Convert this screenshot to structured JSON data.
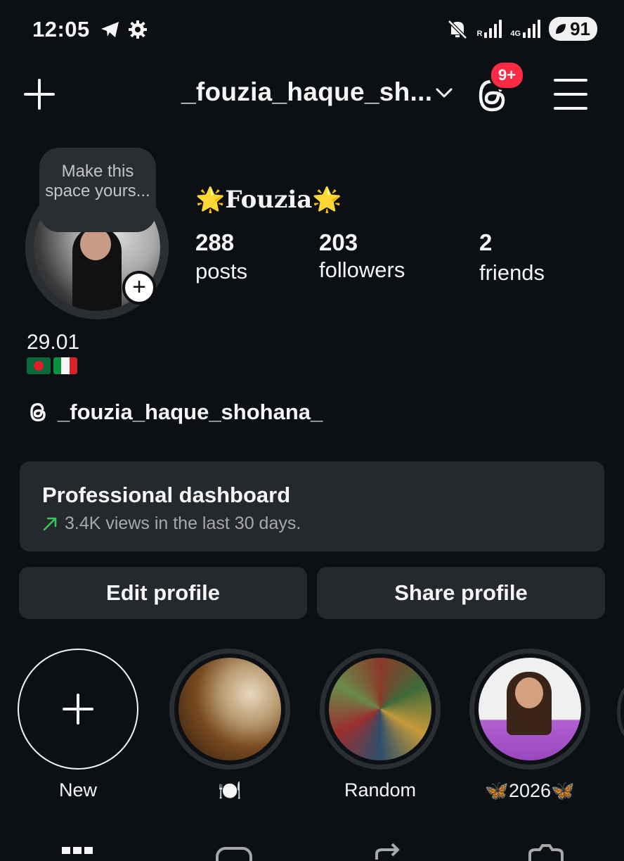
{
  "status_bar": {
    "time": "12:05",
    "network_1": "R",
    "network_2": "4G",
    "battery": "91"
  },
  "header": {
    "username": "_fouzia_haque_sh...",
    "notification_badge": "9+"
  },
  "profile": {
    "note_text": "Make this space yours...",
    "display_name": "🌟Fouzia🌟",
    "stats": [
      {
        "value": "288",
        "label": "posts"
      },
      {
        "value": "203",
        "label": "followers"
      },
      {
        "value": "2",
        "label": "friends"
      }
    ],
    "bio_line": "29.01",
    "threads_handle": "_fouzia_haque_shohana_"
  },
  "dashboard": {
    "title": "Professional dashboard",
    "subtitle": "3.4K views in the last 30 days."
  },
  "actions": {
    "edit": "Edit profile",
    "share": "Share profile"
  },
  "highlights": [
    {
      "label": "New"
    },
    {
      "label": "🍽️"
    },
    {
      "label": "Random"
    },
    {
      "label": "🦋2026🦋"
    }
  ],
  "colors": {
    "background": "#0c1014",
    "card": "#25292e",
    "badge": "#ff2b44",
    "trend_green": "#34c759"
  }
}
